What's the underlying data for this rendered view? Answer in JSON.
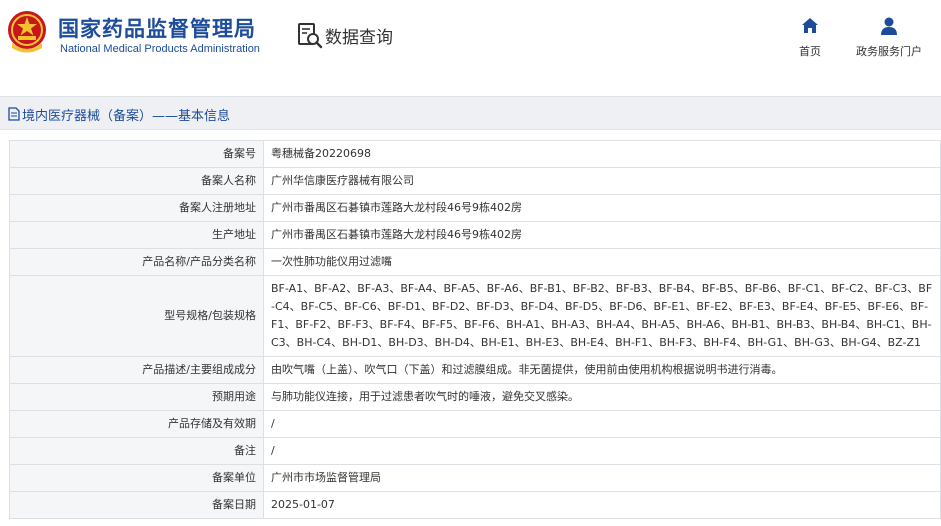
{
  "header": {
    "org_name_cn": "国家药品监督管理局",
    "org_name_en": "National Medical Products Administration",
    "query_label": "数据查询",
    "emblem_icon": "national-emblem-icon",
    "nav": [
      {
        "label": "首页",
        "icon": "home-icon"
      },
      {
        "label": "政务服务门户",
        "icon": "user-icon"
      }
    ]
  },
  "section": {
    "title": "境内医疗器械（备案）——基本信息",
    "icon": "document-icon"
  },
  "colors": {
    "brand_blue": "#1d4c9a",
    "label_bg": "#f5f6f8",
    "border": "#dcdfe4"
  },
  "record": {
    "rows": [
      {
        "label": "备案号",
        "value": "粤穗械备20220698"
      },
      {
        "label": "备案人名称",
        "value": "广州华信康医疗器械有限公司"
      },
      {
        "label": "备案人注册地址",
        "value": "广州市番禺区石碁镇市莲路大龙村段46号9栋402房"
      },
      {
        "label": "生产地址",
        "value": "广州市番禺区石碁镇市莲路大龙村段46号9栋402房"
      },
      {
        "label": "产品名称/产品分类名称",
        "value": "一次性肺功能仪用过滤嘴"
      },
      {
        "label": "型号规格/包装规格",
        "value": "BF-A1、BF-A2、BF-A3、BF-A4、BF-A5、BF-A6、BF-B1、BF-B2、BF-B3、BF-B4、BF-B5、BF-B6、BF-C1、BF-C2、BF-C3、BF-C4、BF-C5、BF-C6、BF-D1、BF-D2、BF-D3、BF-D4、BF-D5、BF-D6、BF-E1、BF-E2、BF-E3、BF-E4、BF-E5、BF-E6、BF-F1、BF-F2、BF-F3、BF-F4、BF-F5、BF-F6、BH-A1、BH-A3、BH-A4、BH-A5、BH-A6、BH-B1、BH-B3、BH-B4、BH-C1、BH-C3、BH-C4、BH-D1、BH-D3、BH-D4、BH-E1、BH-E3、BH-E4、BH-F1、BH-F3、BH-F4、BH-G1、BH-G3、BH-G4、BZ-Z1"
      },
      {
        "label": "产品描述/主要组成成分",
        "value": "由吹气嘴（上盖）、吹气口（下盖）和过滤膜组成。非无菌提供，使用前由使用机构根据说明书进行消毒。"
      },
      {
        "label": "预期用途",
        "value": "与肺功能仪连接，用于过滤患者吹气时的唾液，避免交叉感染。"
      },
      {
        "label": "产品存储及有效期",
        "value": "/"
      },
      {
        "label": "备注",
        "value": "/"
      },
      {
        "label": "备案单位",
        "value": "广州市市场监督管理局"
      },
      {
        "label": "备案日期",
        "value": "2025-01-07"
      }
    ]
  }
}
